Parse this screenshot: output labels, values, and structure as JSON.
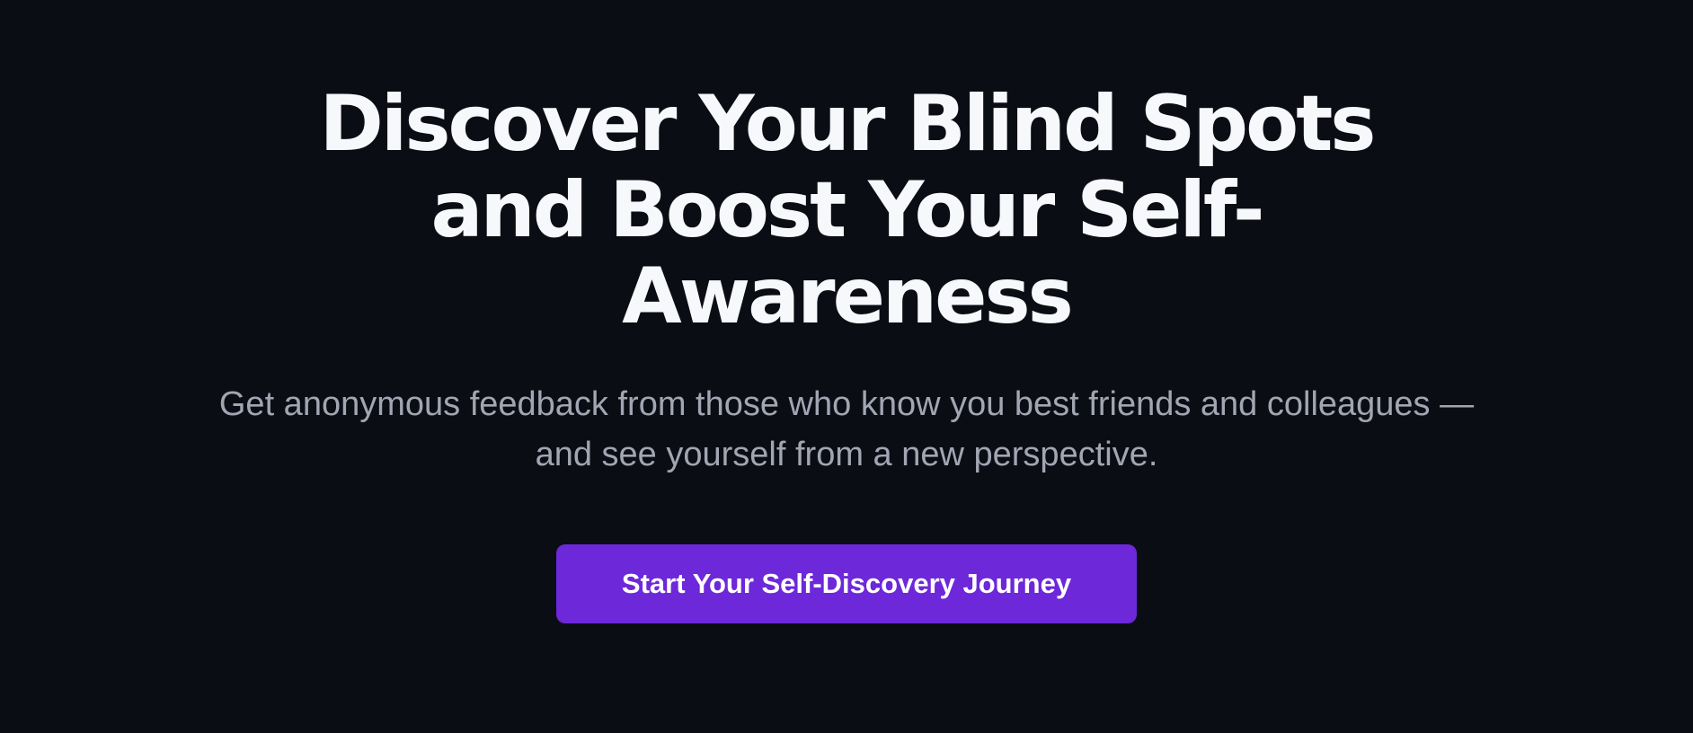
{
  "hero": {
    "title_lines": [
      "Discover Your Blind Spots",
      "and Boost Your Self-",
      "Awareness"
    ],
    "subtitle_lines": [
      "Get anonymous feedback from those who know you best friends and colleagues —",
      "and see yourself from a new perspective."
    ],
    "cta_label": "Start Your Self-Discovery Journey"
  },
  "colors": {
    "background": "#0b0d14",
    "title": "#f7f8fb",
    "subtitle": "#a2a5b2",
    "accent": "#6d28d9"
  }
}
